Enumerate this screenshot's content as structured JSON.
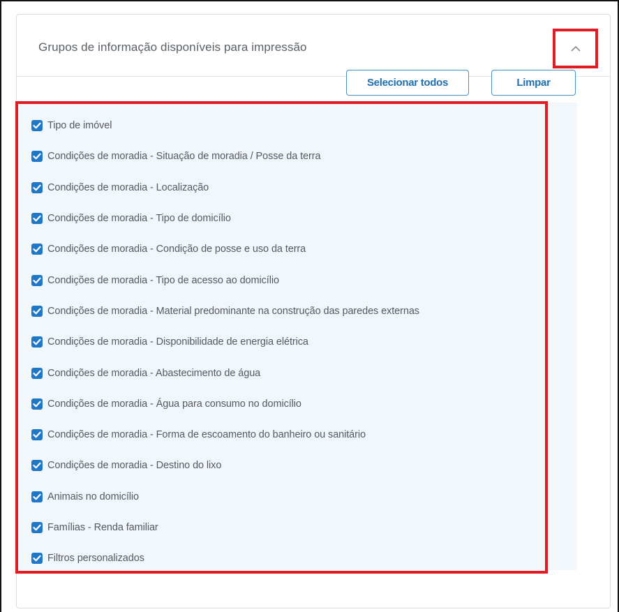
{
  "panel": {
    "title": "Grupos de informação disponíveis para impressão",
    "collapse_icon": "chevron-up-icon"
  },
  "toolbar": {
    "select_all_label": "Selecionar todos",
    "clear_label": "Limpar"
  },
  "colors": {
    "accent": "#1f77c8",
    "highlight_border": "#e01b24",
    "list_background": "#f2f7fc"
  },
  "items": [
    {
      "label": "Tipo de imóvel",
      "checked": true
    },
    {
      "label": "Condições de moradia - Situação de moradia / Posse da terra",
      "checked": true
    },
    {
      "label": "Condições de moradia - Localização",
      "checked": true
    },
    {
      "label": "Condições de moradia - Tipo de domicílio",
      "checked": true
    },
    {
      "label": "Condições de moradia - Condição de posse e uso da terra",
      "checked": true
    },
    {
      "label": "Condições de moradia - Tipo de acesso ao domicílio",
      "checked": true
    },
    {
      "label": "Condições de moradia - Material predominante na construção das paredes externas",
      "checked": true
    },
    {
      "label": "Condições de moradia - Disponibilidade de energia elétrica",
      "checked": true
    },
    {
      "label": "Condições de moradia - Abastecimento de água",
      "checked": true
    },
    {
      "label": "Condições de moradia - Água para consumo no domicílio",
      "checked": true
    },
    {
      "label": "Condições de moradia - Forma de escoamento do banheiro ou sanitário",
      "checked": true
    },
    {
      "label": "Condições de moradia - Destino do lixo",
      "checked": true
    },
    {
      "label": "Animais no domicílio",
      "checked": true
    },
    {
      "label": "Famílias - Renda familiar",
      "checked": true
    },
    {
      "label": "Filtros personalizados",
      "checked": true
    }
  ]
}
